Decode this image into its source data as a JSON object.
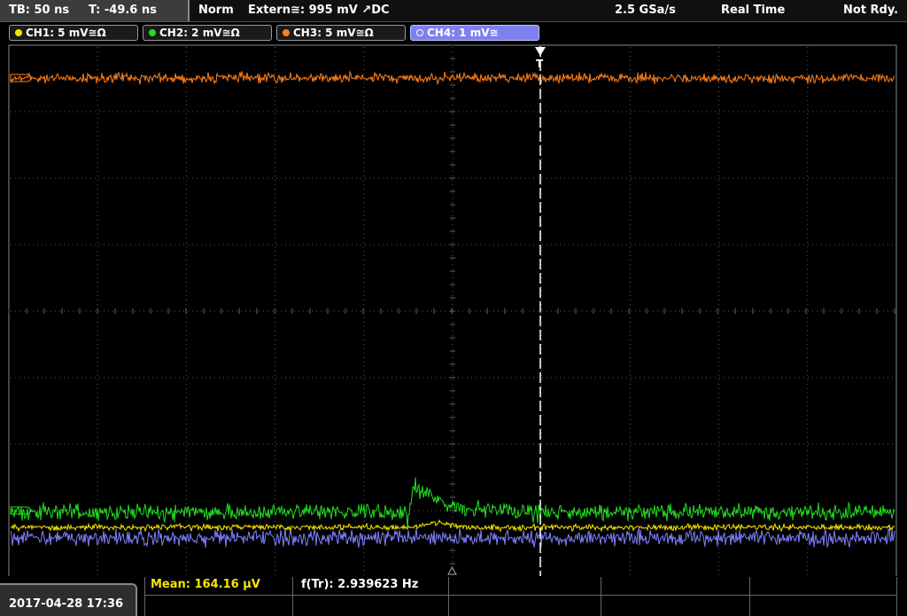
{
  "topbar": {
    "timebase": "TB: 50 ns",
    "trigger_time": "T: -49.6 ns",
    "trigger_mode": "Norm",
    "trigger_source": "Extern≅: 995 mV ↗DC",
    "sample_rate": "2.5 GSa/s",
    "acq_mode": "Real Time",
    "status": "Not Rdy."
  },
  "channels": [
    {
      "label": "CH1: 5 mV≅Ω",
      "color": "#f5e600",
      "active": false
    },
    {
      "label": "CH2: 2 mV≅Ω",
      "color": "#22dd22",
      "active": false
    },
    {
      "label": "CH3: 5 mV≅Ω",
      "color": "#ff7f1a",
      "active": false
    },
    {
      "label": "CH4: 1 mV≅",
      "color": "#8080ff",
      "active": true
    }
  ],
  "waveforms": {
    "ch1_color": "#f5e600",
    "ch2_color": "#22dd22",
    "ch3_color": "#ff7f1a",
    "ch4_color": "#8080ff"
  },
  "measurements": {
    "mean": "Mean: 164.16 µV",
    "frequency": "f(Tr): 2.939623 Hz"
  },
  "datetime": "2017-04-28 17:36"
}
